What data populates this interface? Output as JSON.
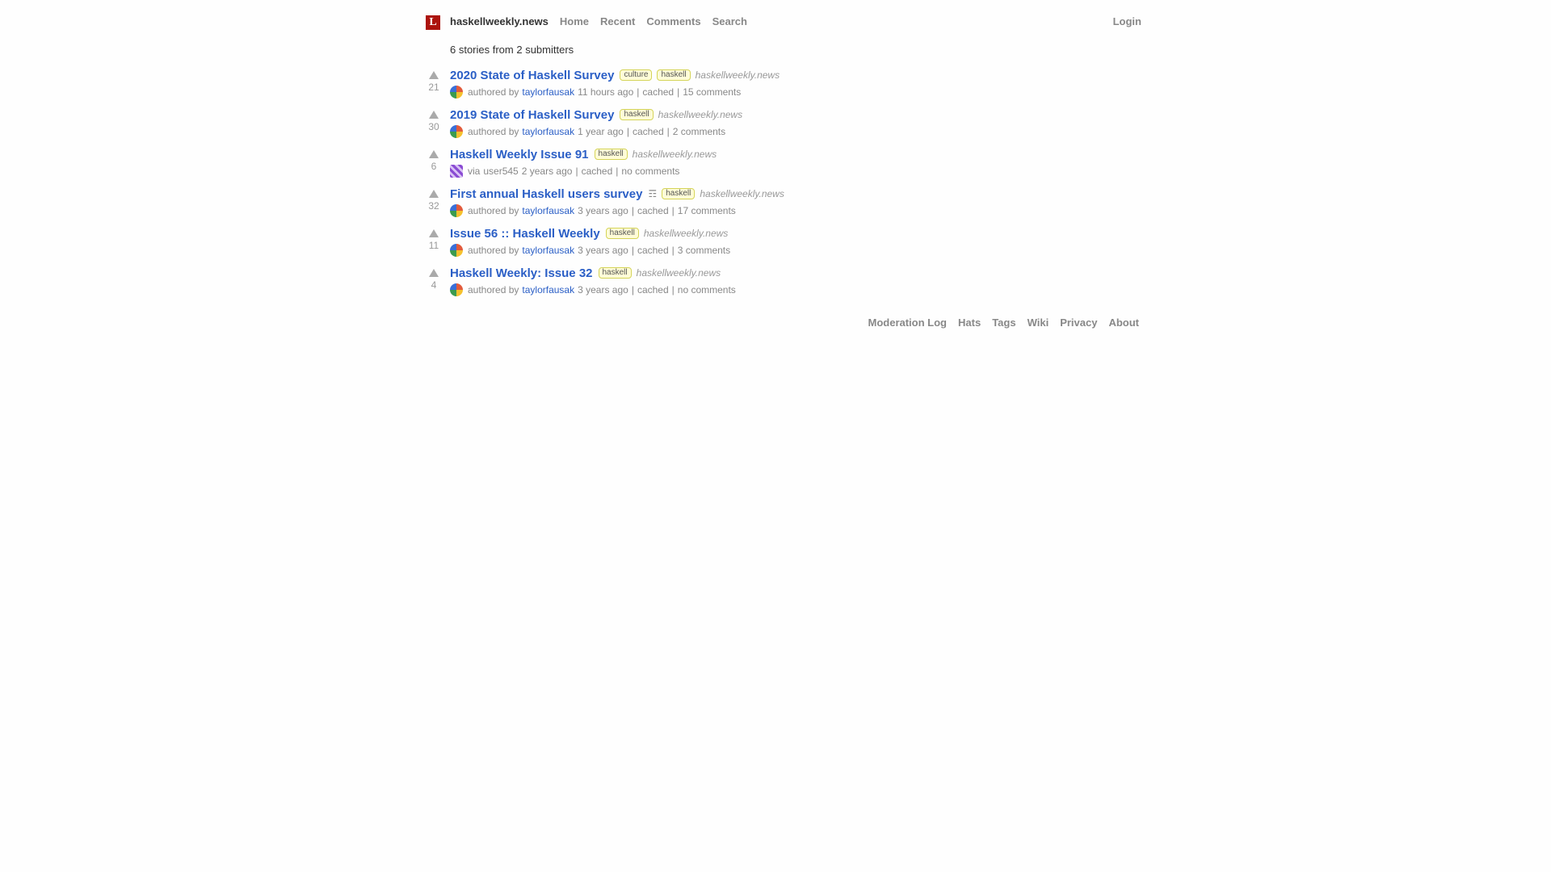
{
  "header": {
    "logo_letter": "L",
    "site": "haskellweekly.news",
    "nav": [
      "Home",
      "Recent",
      "Comments",
      "Search"
    ],
    "login": "Login"
  },
  "summary": "6 stories from 2 submitters",
  "stories": [
    {
      "score": "21",
      "title": "2020 State of Haskell Survey",
      "tags": [
        "culture",
        "haskell"
      ],
      "domain": "haskellweekly.news",
      "by_prefix": "authored by",
      "user": "taylorfausak",
      "age": "11 hours ago",
      "cached": "cached",
      "comments": "15 comments"
    },
    {
      "score": "30",
      "title": "2019 State of Haskell Survey",
      "tags": [
        "haskell"
      ],
      "domain": "haskellweekly.news",
      "by_prefix": "authored by",
      "user": "taylorfausak",
      "age": "1 year ago",
      "cached": "cached",
      "comments": "2 comments"
    },
    {
      "score": "6",
      "title": "Haskell Weekly Issue 91",
      "tags": [
        "haskell"
      ],
      "domain": "haskellweekly.news",
      "by_prefix": "via",
      "user": "user545",
      "age": "2 years ago",
      "cached": "cached",
      "comments": "no comments"
    },
    {
      "score": "32",
      "title": "First annual Haskell users survey",
      "desc_icon": "☶",
      "tags": [
        "haskell"
      ],
      "domain": "haskellweekly.news",
      "by_prefix": "authored by",
      "user": "taylorfausak",
      "age": "3 years ago",
      "cached": "cached",
      "comments": "17 comments"
    },
    {
      "score": "11",
      "title": "Issue 56 :: Haskell Weekly",
      "tags": [
        "haskell"
      ],
      "domain": "haskellweekly.news",
      "by_prefix": "authored by",
      "user": "taylorfausak",
      "age": "3 years ago",
      "cached": "cached",
      "comments": "3 comments"
    },
    {
      "score": "4",
      "title": "Haskell Weekly: Issue 32",
      "tags": [
        "haskell"
      ],
      "domain": "haskellweekly.news",
      "by_prefix": "authored by",
      "user": "taylorfausak",
      "age": "3 years ago",
      "cached": "cached",
      "comments": "no comments"
    }
  ],
  "footer": [
    "Moderation Log",
    "Hats",
    "Tags",
    "Wiki",
    "Privacy",
    "About"
  ],
  "colors": {
    "link": "#2b5fc6",
    "logo_bg": "#ac130d",
    "tag_bg": "#fffcd7",
    "tag_border": "#d5d458",
    "muted": "#888888"
  }
}
